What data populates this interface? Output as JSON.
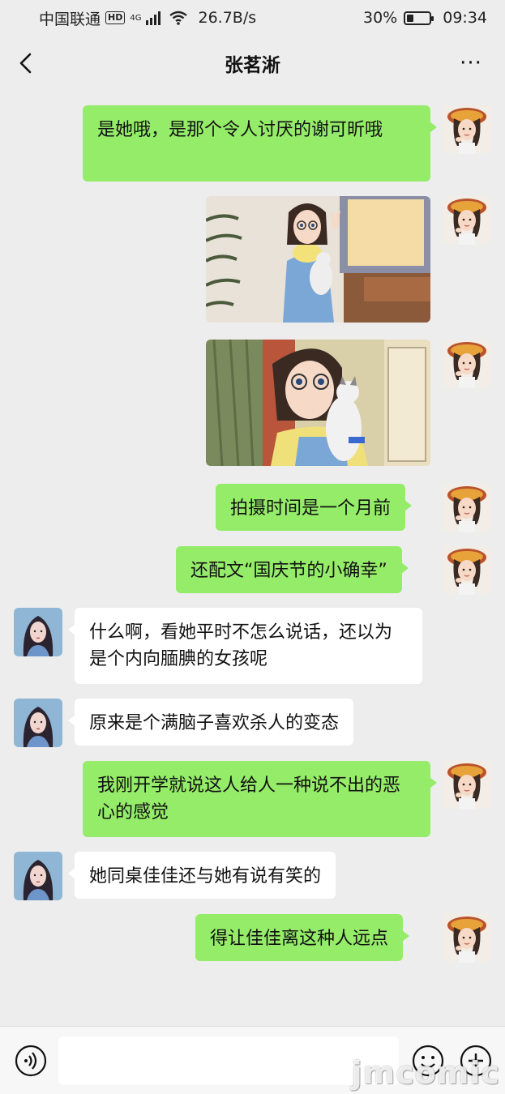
{
  "status_bar": {
    "carrier": "中国联通",
    "hd": "HD",
    "network": "4G",
    "speed": "26.7B/s",
    "battery": "30%",
    "battery_level": 0.3,
    "time": "09:34"
  },
  "header": {
    "title": "张茗淅",
    "more": "···"
  },
  "messages": [
    {
      "sender": "me",
      "type": "text",
      "text": "是她哦，是那个令人讨厌的谢可昕哦"
    },
    {
      "sender": "me",
      "type": "image",
      "image": "girl-with-cat-photo"
    },
    {
      "sender": "me",
      "type": "image",
      "image": "girl-with-cat-closeup-photo"
    },
    {
      "sender": "me",
      "type": "text",
      "text": "拍摄时间是一个月前"
    },
    {
      "sender": "me",
      "type": "text",
      "text": "还配文“国庆节的小确幸”"
    },
    {
      "sender": "other",
      "type": "text",
      "text": "什么啊，看她平时不怎么说话，还以为是个内向腼腆的女孩呢"
    },
    {
      "sender": "other",
      "type": "text",
      "text": "原来是个满脑子喜欢杀人的变态"
    },
    {
      "sender": "me",
      "type": "text",
      "text": "我刚开学就说这人给人一种说不出的恶心的感觉"
    },
    {
      "sender": "other",
      "type": "text",
      "text": "她同桌佳佳还与她有说有笑的"
    },
    {
      "sender": "me",
      "type": "text",
      "text": "得让佳佳离这种人远点"
    }
  ],
  "input_bar": {
    "value": "",
    "voice_icon": "voice-icon",
    "emoji_icon": "emoji-icon",
    "plus_icon": "plus-icon"
  },
  "watermark": "jmcomic",
  "colors": {
    "background": "#ededed",
    "my_bubble": "#95ec69",
    "other_bubble": "#ffffff"
  }
}
